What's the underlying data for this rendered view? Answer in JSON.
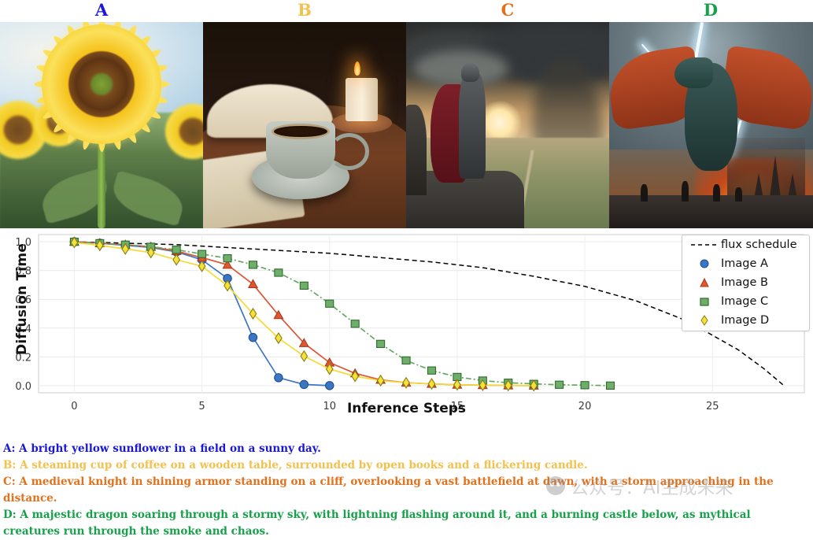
{
  "panels": [
    {
      "letter": "A",
      "color": "#1a18d6",
      "image_name": "sunflower-field-image"
    },
    {
      "letter": "B",
      "color": "#f2c14e",
      "image_name": "coffee-books-candle-image"
    },
    {
      "letter": "C",
      "color": "#e2711d",
      "image_name": "knight-cliff-image"
    },
    {
      "letter": "D",
      "color": "#18a04a",
      "image_name": "dragon-storm-image"
    }
  ],
  "chart_data": {
    "type": "line",
    "title": "",
    "xlabel": "Inference Steps",
    "ylabel": "Diffusion Time",
    "xlim": [
      -1.4,
      28.6
    ],
    "ylim": [
      -0.05,
      1.05
    ],
    "xticks": [
      0,
      5,
      10,
      15,
      20,
      25
    ],
    "yticks": [
      "0.0",
      "0.2",
      "0.4",
      "0.6",
      "0.8",
      "1.0"
    ],
    "grid": true,
    "legend_position": "upper right",
    "series": [
      {
        "name": "flux schedule",
        "style": "dashed",
        "color": "#000000",
        "marker": "none",
        "x": [
          0,
          2,
          4,
          6,
          8,
          10,
          12,
          14,
          16,
          18,
          20,
          22,
          24,
          26,
          27,
          27.8
        ],
        "y": [
          1.0,
          0.99,
          0.98,
          0.96,
          0.94,
          0.92,
          0.89,
          0.86,
          0.82,
          0.76,
          0.69,
          0.59,
          0.45,
          0.25,
          0.12,
          0.0
        ]
      },
      {
        "name": "Image A",
        "style": "solid",
        "color": "#3b76c4",
        "marker": "circle",
        "x": [
          0,
          1,
          2,
          3,
          4,
          5,
          6,
          7,
          8,
          9,
          10
        ],
        "y": [
          1.0,
          0.99,
          0.975,
          0.96,
          0.93,
          0.875,
          0.745,
          0.335,
          0.055,
          0.008,
          0.0
        ]
      },
      {
        "name": "Image B",
        "style": "solid",
        "color": "#dd5436",
        "marker": "triangle",
        "x": [
          0,
          1,
          2,
          3,
          4,
          5,
          6,
          7,
          8,
          9,
          10,
          11,
          12,
          13,
          14,
          15,
          16,
          17,
          18
        ],
        "y": [
          1.0,
          0.99,
          0.98,
          0.965,
          0.935,
          0.89,
          0.84,
          0.705,
          0.49,
          0.295,
          0.16,
          0.085,
          0.04,
          0.02,
          0.012,
          0.006,
          0.003,
          0.001,
          0.0
        ]
      },
      {
        "name": "Image C",
        "style": "dashdot",
        "color": "#66a861",
        "marker": "square",
        "x": [
          0,
          1,
          2,
          3,
          4,
          5,
          6,
          7,
          8,
          9,
          10,
          11,
          12,
          13,
          14,
          15,
          16,
          17,
          18,
          19,
          20,
          21
        ],
        "y": [
          1.0,
          0.99,
          0.98,
          0.965,
          0.945,
          0.915,
          0.885,
          0.84,
          0.785,
          0.695,
          0.57,
          0.43,
          0.29,
          0.175,
          0.105,
          0.06,
          0.035,
          0.02,
          0.012,
          0.006,
          0.003,
          0.0
        ]
      },
      {
        "name": "Image D",
        "style": "solid",
        "color": "#f2dc34",
        "marker": "diamond",
        "x": [
          0,
          1,
          2,
          3,
          4,
          5,
          6,
          7,
          8,
          9,
          10,
          11,
          12,
          13,
          14,
          15,
          16,
          17,
          18
        ],
        "y": [
          0.995,
          0.975,
          0.95,
          0.925,
          0.875,
          0.83,
          0.695,
          0.5,
          0.33,
          0.205,
          0.115,
          0.065,
          0.035,
          0.02,
          0.012,
          0.006,
          0.003,
          0.001,
          0.0
        ]
      }
    ]
  },
  "legend": {
    "items": [
      {
        "label": "flux schedule",
        "marker": "dashed-line",
        "color": "#000000"
      },
      {
        "label": "Image A",
        "marker": "circle",
        "color": "#3b76c4"
      },
      {
        "label": "Image B",
        "marker": "triangle",
        "color": "#dd5436"
      },
      {
        "label": "Image C",
        "marker": "square",
        "color": "#66a861"
      },
      {
        "label": "Image D",
        "marker": "diamond",
        "color": "#f2dc34"
      }
    ]
  },
  "captions": [
    {
      "text": "A: A bright yellow sunflower in a field on a sunny day.",
      "color": "#1a18d6"
    },
    {
      "text": "B: A steaming cup of coffee on a wooden table, surrounded by open books and a flickering candle.",
      "color": "#f2c14e"
    },
    {
      "text": "C: A medieval knight in shining armor standing on a cliff, overlooking a vast battlefield at dawn, with a storm approaching in the distance.",
      "color": "#e2711d"
    },
    {
      "text": "D: A majestic dragon soaring through a stormy sky, with lightning flashing around it, and a burning castle below, as mythical creatures run through the smoke and chaos.",
      "color": "#18a04a"
    }
  ],
  "watermark": {
    "text": "公众号：AI生成未来"
  }
}
